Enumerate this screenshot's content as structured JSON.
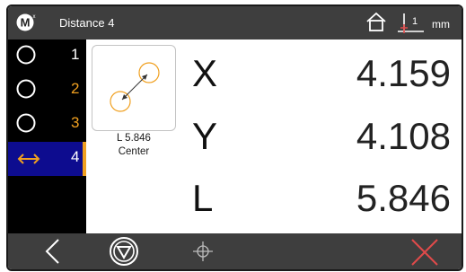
{
  "window": {
    "title": "Distance 4",
    "units": "mm",
    "origin_indicator": "1",
    "logo_letter": "M",
    "logo_superscript": "x"
  },
  "sidebar": {
    "items": [
      {
        "number": "1",
        "icon": "circle-icon",
        "number_color": "#ffffff",
        "selected": false
      },
      {
        "number": "2",
        "icon": "circle-icon",
        "number_color": "#f0a020",
        "selected": false
      },
      {
        "number": "3",
        "icon": "circle-icon",
        "number_color": "#f0a020",
        "selected": false
      },
      {
        "number": "4",
        "icon": "double-arrow-icon",
        "number_color": "#ffffff",
        "selected": true
      }
    ]
  },
  "thumbnail": {
    "line1": "L 5.846",
    "line2": "Center"
  },
  "readouts": [
    {
      "axis": "X",
      "value": "4.159"
    },
    {
      "axis": "Y",
      "value": "4.108"
    },
    {
      "axis": "L",
      "value": "5.846"
    }
  ],
  "toolbar": {
    "buttons": [
      "back-icon",
      "menu-triangle-icon",
      "crosshair-icon",
      "close-icon"
    ]
  },
  "colors": {
    "titlebar": "#3e3e3e",
    "selected_bg": "#0d0c8f",
    "accent_orange": "#f0a020",
    "close_red": "#e04a4a"
  }
}
